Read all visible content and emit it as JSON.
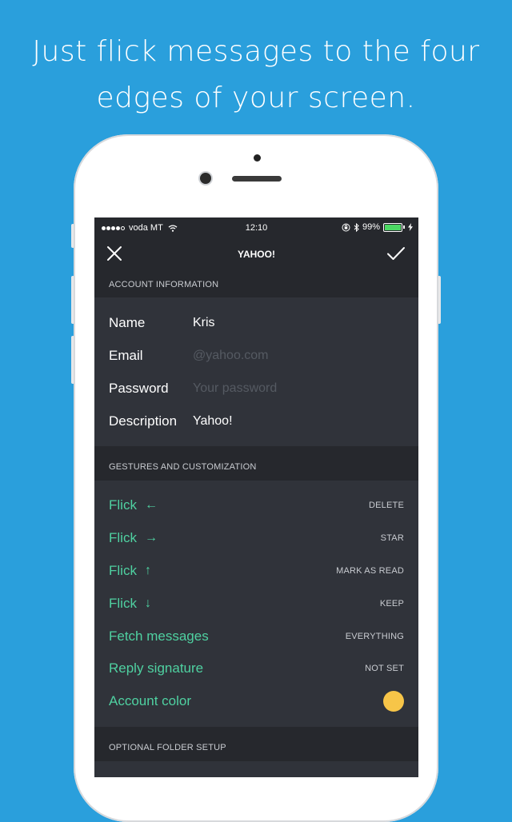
{
  "headline": {
    "line1": "Just flick messages to the four",
    "line2": "edges of your screen."
  },
  "status_bar": {
    "carrier": "voda MT",
    "time": "12:10",
    "battery_percent": "99%",
    "battery_level": 0.99
  },
  "nav": {
    "title": "YAHOO!",
    "close_icon": "close-icon",
    "confirm_icon": "checkmark-icon"
  },
  "account": {
    "header": "ACCOUNT INFORMATION",
    "fields": [
      {
        "label": "Name",
        "value": "Kris"
      },
      {
        "label": "Email",
        "value": "",
        "placeholder": "@yahoo.com"
      },
      {
        "label": "Password",
        "value": "",
        "placeholder": "Your password"
      },
      {
        "label": "Description",
        "value": "Yahoo!"
      }
    ]
  },
  "gestures": {
    "header": "GESTURES AND CUSTOMIZATION",
    "rows": [
      {
        "label": "Flick",
        "arrow": "←",
        "value": "DELETE"
      },
      {
        "label": "Flick",
        "arrow": "→",
        "value": "STAR"
      },
      {
        "label": "Flick",
        "arrow": "↑",
        "value": "MARK AS READ"
      },
      {
        "label": "Flick",
        "arrow": "↓",
        "value": "KEEP"
      },
      {
        "label": "Fetch messages",
        "value": "EVERYTHING"
      },
      {
        "label": "Reply signature",
        "value": "NOT SET"
      },
      {
        "label": "Account color",
        "color": "#f7c548"
      }
    ]
  },
  "folders": {
    "header": "OPTIONAL FOLDER SETUP"
  },
  "colors": {
    "background": "#2a9fdc",
    "accent": "#4fd1a1",
    "account_color": "#f7c548"
  }
}
